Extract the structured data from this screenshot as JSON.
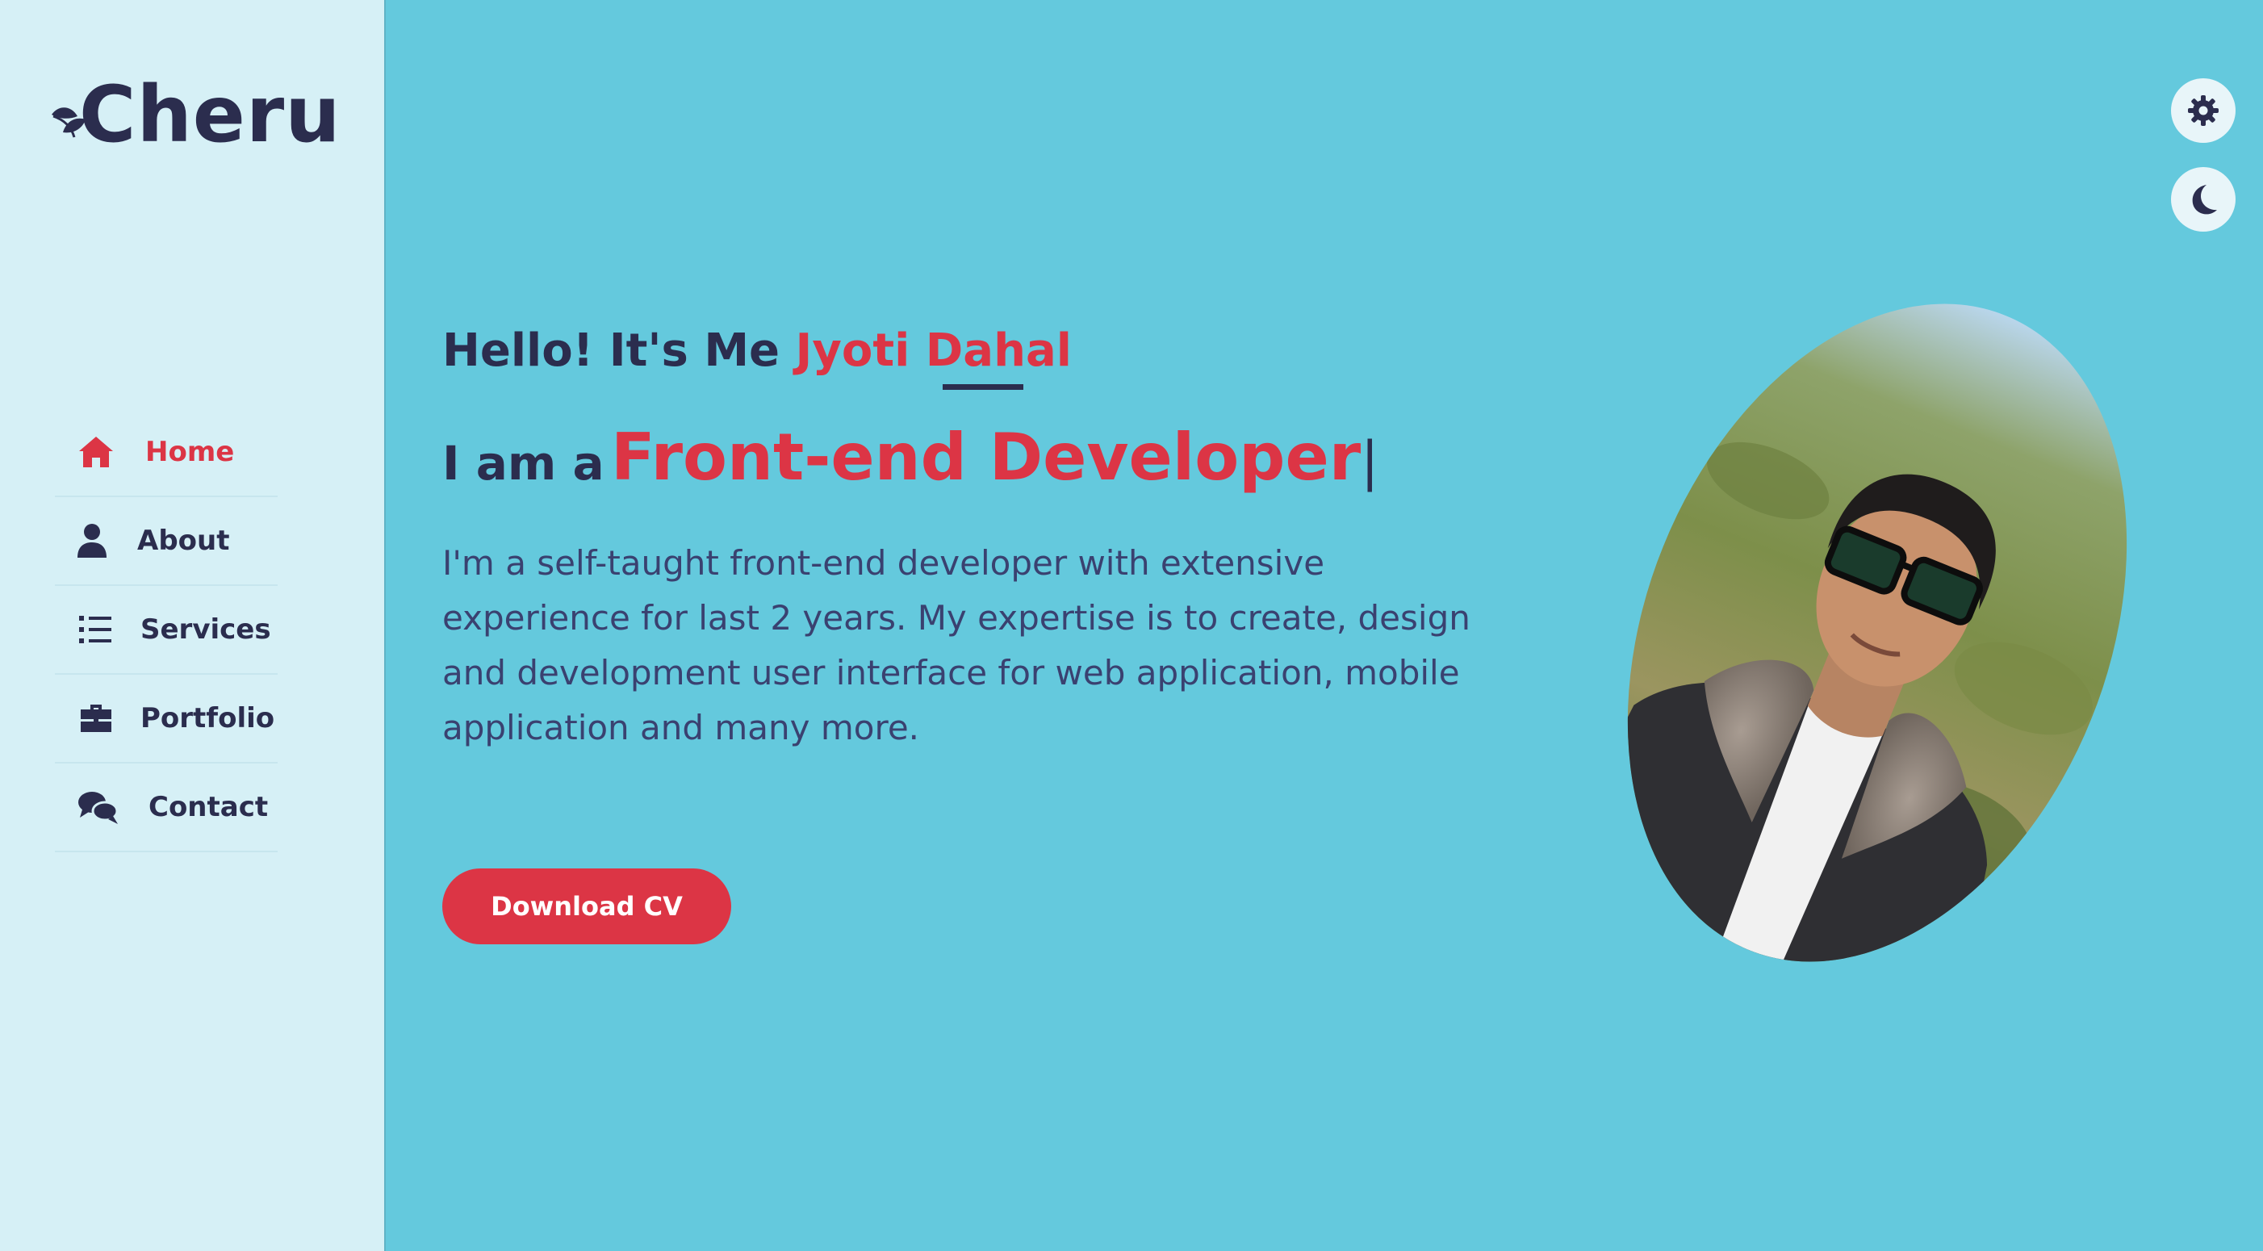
{
  "brand": {
    "logo_text": "Cheru",
    "logo_icon": "leaf-icon"
  },
  "sidebar": {
    "items": [
      {
        "label": "Home",
        "icon": "home-icon",
        "active": true
      },
      {
        "label": "About",
        "icon": "user-icon",
        "active": false
      },
      {
        "label": "Services",
        "icon": "list-icon",
        "active": false
      },
      {
        "label": "Portfolio",
        "icon": "briefcase-icon",
        "active": false
      },
      {
        "label": "Contact",
        "icon": "comments-icon",
        "active": false
      }
    ]
  },
  "controls": {
    "settings_icon": "gear-icon",
    "theme_icon": "moon-icon"
  },
  "hero": {
    "greeting": "Hello! It's Me",
    "name": "Jyoti Dahal",
    "role_prefix": "I am a",
    "role": "Front-end Developer",
    "caret": "|",
    "description": "I'm a self-taught front-end developer with extensive experience for last 2 years. My expertise is to create, design and development user interface for web application, mobile application and many more.",
    "cta_label": "Download CV"
  },
  "colors": {
    "accent": "#dc3545",
    "text_dark": "#2b2d4e",
    "background": "#64c9dd",
    "sidebar_bg": "#d6f0f6"
  }
}
